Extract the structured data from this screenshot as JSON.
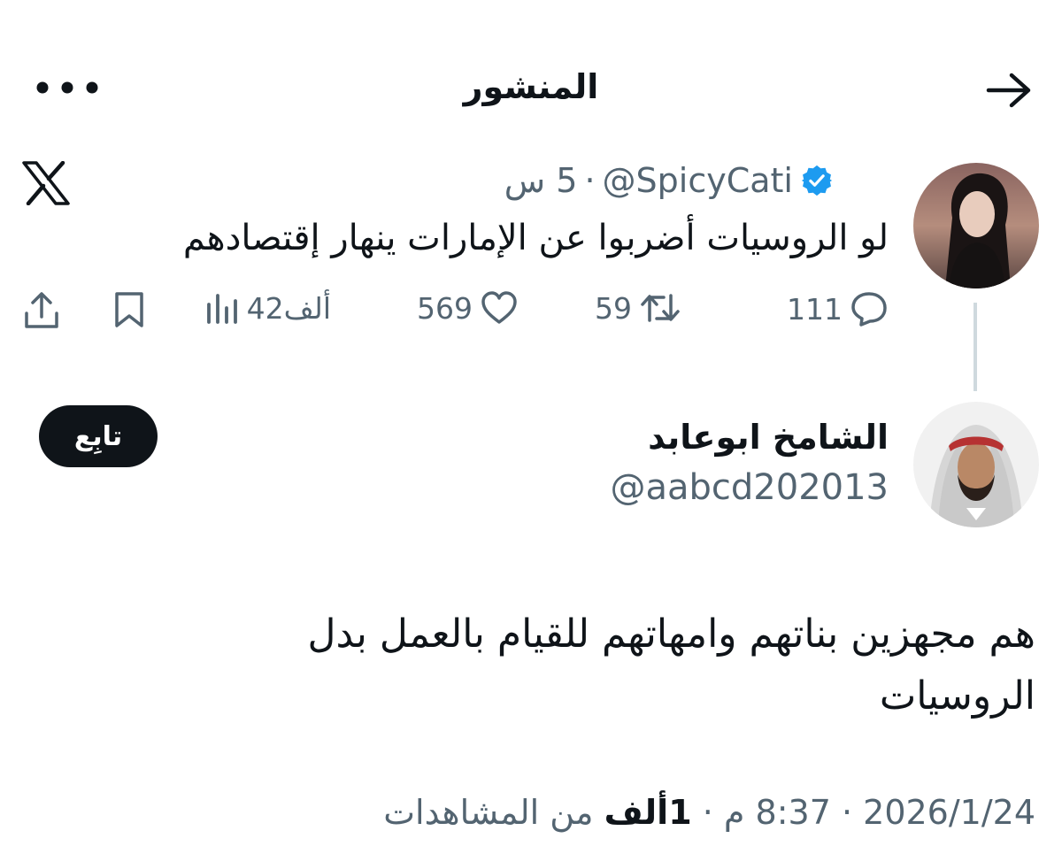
{
  "header": {
    "title": "المنشور",
    "back_icon": "arrow-right-icon",
    "more_icon": "more-horizontal-icon"
  },
  "quoted_post": {
    "handle": "@SpicyCati",
    "separator": "·",
    "time": "5 س",
    "text": "لو الروسيات أضربوا عن الإمارات ينهار إقتصادهم",
    "actions": {
      "replies": "111",
      "reposts": "59",
      "likes": "569",
      "views": "42ألف"
    }
  },
  "post": {
    "author_name": "الشامخ ابوعابد",
    "author_handle": "@aabcd202013",
    "follow_label": "تابِع",
    "text": "هم مجهزين بناتهم وامهاتهم للقيام بالعمل بدل الروسيات",
    "date": "2026/1/24",
    "time": "8:37 م",
    "views_count": "1ألف",
    "views_label": "من المشاهدات",
    "separator": "·"
  },
  "colors": {
    "text": "#0f1419",
    "secondary": "#536471",
    "verified": "#1d9bf0",
    "follow_bg": "#0f1419",
    "thread_line": "#cfd9de"
  }
}
